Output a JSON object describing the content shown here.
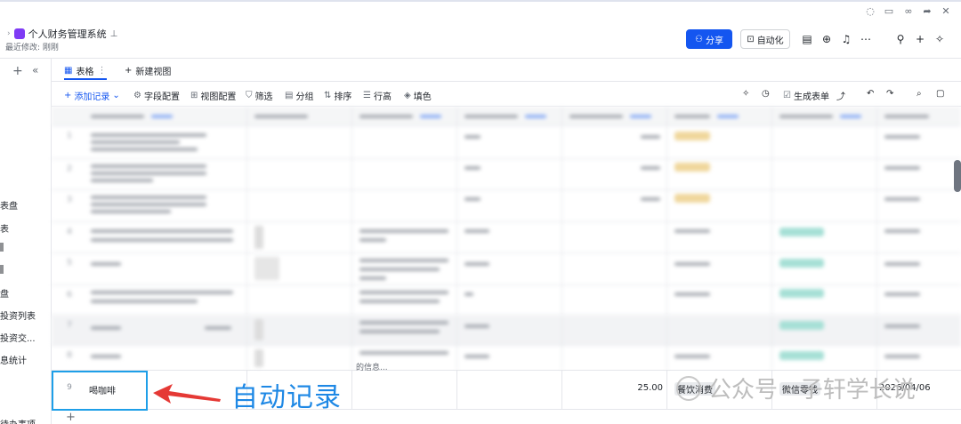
{
  "header": {
    "title": "个人财务管理系统",
    "subtitle": "最近修改: 刚刚",
    "share_label": "分享",
    "auto_label": "自动化"
  },
  "sidebar": {
    "items": [
      "表盘",
      "表",
      "",
      "",
      "盘",
      "投资列表",
      "投资交...",
      "息统计",
      "",
      "待办事项"
    ]
  },
  "tabs": {
    "table": "表格",
    "new_view": "新建视图"
  },
  "toolbar": {
    "add_record": "添加记录",
    "field_config": "字段配置",
    "view_config": "视图配置",
    "filter": "筛选",
    "group": "分组",
    "sort": "排序",
    "row_height": "行高",
    "fill_color": "填色",
    "gen_form": "生成表单"
  },
  "new_record": {
    "index": "9",
    "name": "喝咖啡",
    "amount": "25.00",
    "category": "餐饮消费",
    "payment": "微信零钱",
    "date": "2026/04/06"
  },
  "blurred_row": {
    "partial_text": "的信息..."
  },
  "annotation": {
    "callout": "自动记录"
  },
  "watermark": {
    "text": "公众号 · 子轩学长说"
  },
  "colors": {
    "accent": "#1456f0",
    "callout": "#1e88e5",
    "highlight_border": "#1e9fe8",
    "arrow": "#e53935"
  }
}
